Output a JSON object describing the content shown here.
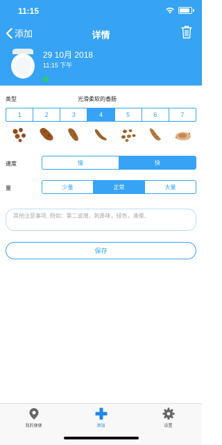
{
  "status_bar": {
    "time": "11:15"
  },
  "nav": {
    "back_label": "添加",
    "title": "详情"
  },
  "entry": {
    "date": "29 10月 2018",
    "time": "11:15 下午"
  },
  "type_section": {
    "label": "类型",
    "description": "光滑柔软的香肠",
    "options": [
      "1",
      "2",
      "3",
      "4",
      "5",
      "6",
      "7"
    ],
    "selected": "4"
  },
  "speed": {
    "label": "速度",
    "options": [
      "慢",
      "快"
    ],
    "selected": "快"
  },
  "amount": {
    "label": "量",
    "options": [
      "少量",
      "正常",
      "大量"
    ],
    "selected": "正常"
  },
  "notes": {
    "placeholder": "其他注意事项..例如：第二波潮，刺鼻味，绿色，清擦.."
  },
  "save_label": "保存",
  "tabs": [
    {
      "label": "我的便便",
      "icon": "location-pin-icon"
    },
    {
      "label": "添加",
      "icon": "plus-icon"
    },
    {
      "label": "设置",
      "icon": "gear-icon"
    }
  ],
  "colors": {
    "primary": "#36a3f5",
    "status_dot": "#2ecc71",
    "stool": "#a0612a"
  }
}
